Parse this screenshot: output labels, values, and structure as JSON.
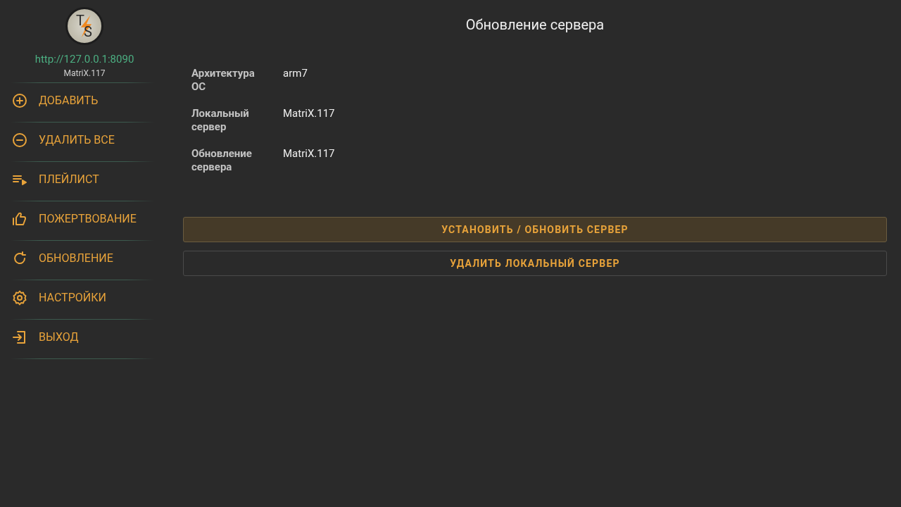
{
  "sidebar": {
    "logo": {
      "letters": [
        "T",
        "S"
      ]
    },
    "server_url": "http://127.0.0.1:8090",
    "server_version": "MatriX.117",
    "items": [
      {
        "kind": "add",
        "label": "ДОБАВИТЬ"
      },
      {
        "kind": "remove",
        "label": "УДАЛИТЬ ВСЕ"
      },
      {
        "kind": "playlist",
        "label": "ПЛЕЙЛИСТ"
      },
      {
        "kind": "donate",
        "label": "ПОЖЕРТВОВАНИЕ"
      },
      {
        "kind": "update",
        "label": "ОБНОВЛЕНИЕ"
      },
      {
        "kind": "settings",
        "label": "НАСТРОЙКИ"
      },
      {
        "kind": "exit",
        "label": "ВЫХОД"
      }
    ]
  },
  "main": {
    "title": "Обновление сервера",
    "info": [
      {
        "label": "Архитектура ОС",
        "value": "arm7"
      },
      {
        "label": "Локальный сервер",
        "value": "MatriX.117"
      },
      {
        "label": "Обновление сервера",
        "value": "MatriX.117"
      }
    ],
    "buttons": [
      {
        "label": "УСТАНОВИТЬ / ОБНОВИТЬ СЕРВЕР",
        "focused": true
      },
      {
        "label": "УДАЛИТЬ ЛОКАЛЬНЫЙ СЕРВЕР",
        "focused": false
      }
    ]
  }
}
